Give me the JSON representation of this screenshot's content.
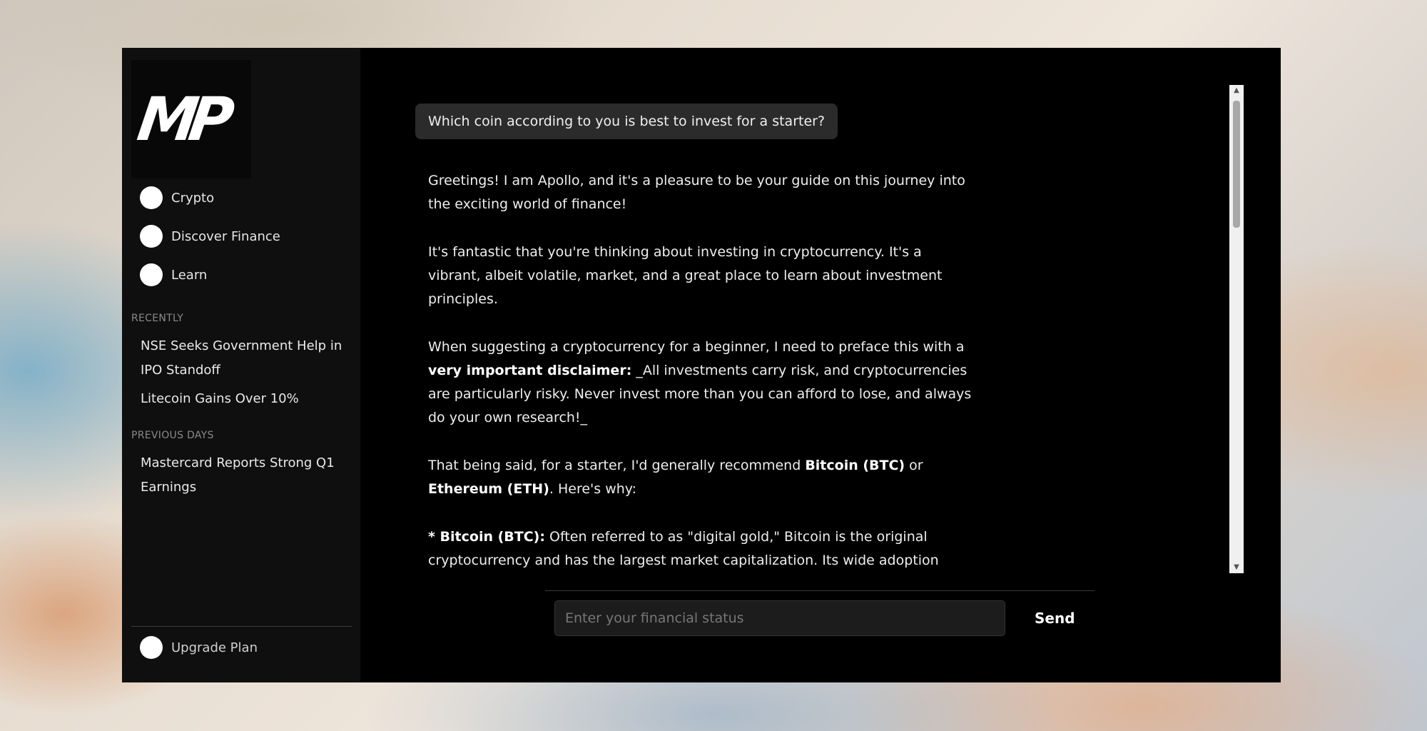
{
  "sidebar": {
    "logo": "MP",
    "nav": [
      {
        "label": "Crypto"
      },
      {
        "label": "Discover Finance"
      },
      {
        "label": "Learn"
      }
    ],
    "recently_title": "RECENTLY",
    "recently": [
      {
        "label": "NSE Seeks Government Help in IPO Standoff"
      },
      {
        "label": "Litecoin Gains Over 10%"
      }
    ],
    "previous_title": "PREVIOUS DAYS",
    "previous": [
      {
        "label": "Mastercard Reports Strong Q1 Earnings"
      }
    ],
    "upgrade_label": "Upgrade Plan"
  },
  "chat": {
    "user_message": "Which coin according to you is best to invest for a starter?",
    "p1": "Greetings! I am Apollo, and it's a pleasure to be your guide on this journey into the exciting world of finance!",
    "p2": "It's fantastic that you're thinking about investing in cryptocurrency. It's a vibrant, albeit volatile, market, and a great place to learn about investment principles.",
    "p3_a": "When suggesting a cryptocurrency for a beginner, I need to preface this with a ",
    "p3_bold": "very important disclaimer:",
    "p3_b": " _All investments carry risk, and cryptocurrencies are particularly risky. Never invest more than you can afford to lose, and always do your own research!_",
    "p4_a": "That being said, for a starter, I'd generally recommend ",
    "p4_bold1": "Bitcoin (BTC)",
    "p4_b": " or ",
    "p4_bold2": "Ethereum (ETH)",
    "p4_c": ". Here's why:",
    "p5_bold": "* Bitcoin (BTC):",
    "p5_text": " Often referred to as \"digital gold,\" Bitcoin is the original cryptocurrency and has the largest market capitalization. Its wide adoption"
  },
  "composer": {
    "placeholder": "Enter your financial status",
    "send_label": "Send"
  }
}
